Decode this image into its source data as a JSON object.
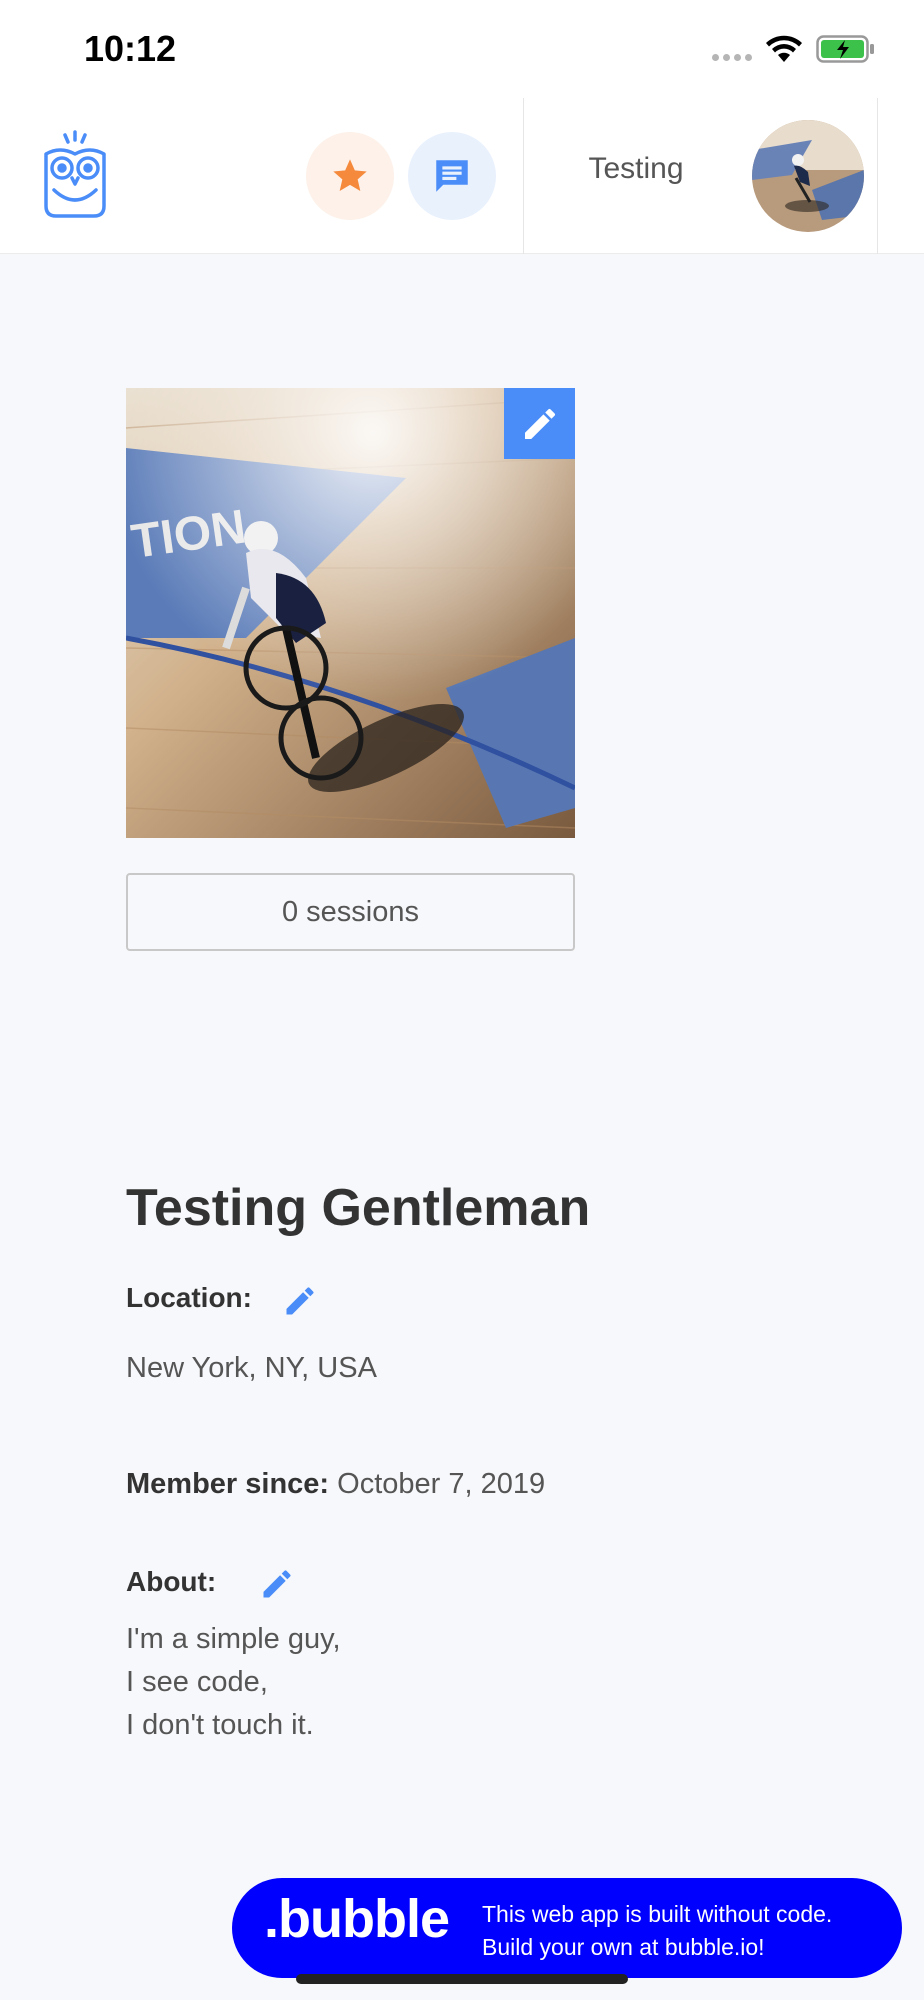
{
  "status_bar": {
    "time": "10:12"
  },
  "header": {
    "username": "Testing",
    "icons": {
      "logo": "owl-logo-icon",
      "favorites": "star-icon",
      "messages": "chat-icon"
    },
    "colors": {
      "star": "#f58a3c",
      "chat": "#4a8df8",
      "logo": "#4a8df8"
    }
  },
  "profile": {
    "sessions_label": "0 sessions",
    "name": "Testing Gentleman",
    "location_label": "Location:",
    "location_value": "New York, NY, USA",
    "member_since_label": "Member since:",
    "member_since_value": "October 7, 2019",
    "about_label": "About:",
    "about_lines": [
      "I'm a simple guy,",
      "I see code,",
      "I don't touch it."
    ]
  },
  "banner": {
    "logo_text": ".bubble",
    "line1": "This web app is built without code.",
    "line2": "Build your own at bubble.io!",
    "color": "#0000ff"
  },
  "accent_color": "#4a8df8"
}
